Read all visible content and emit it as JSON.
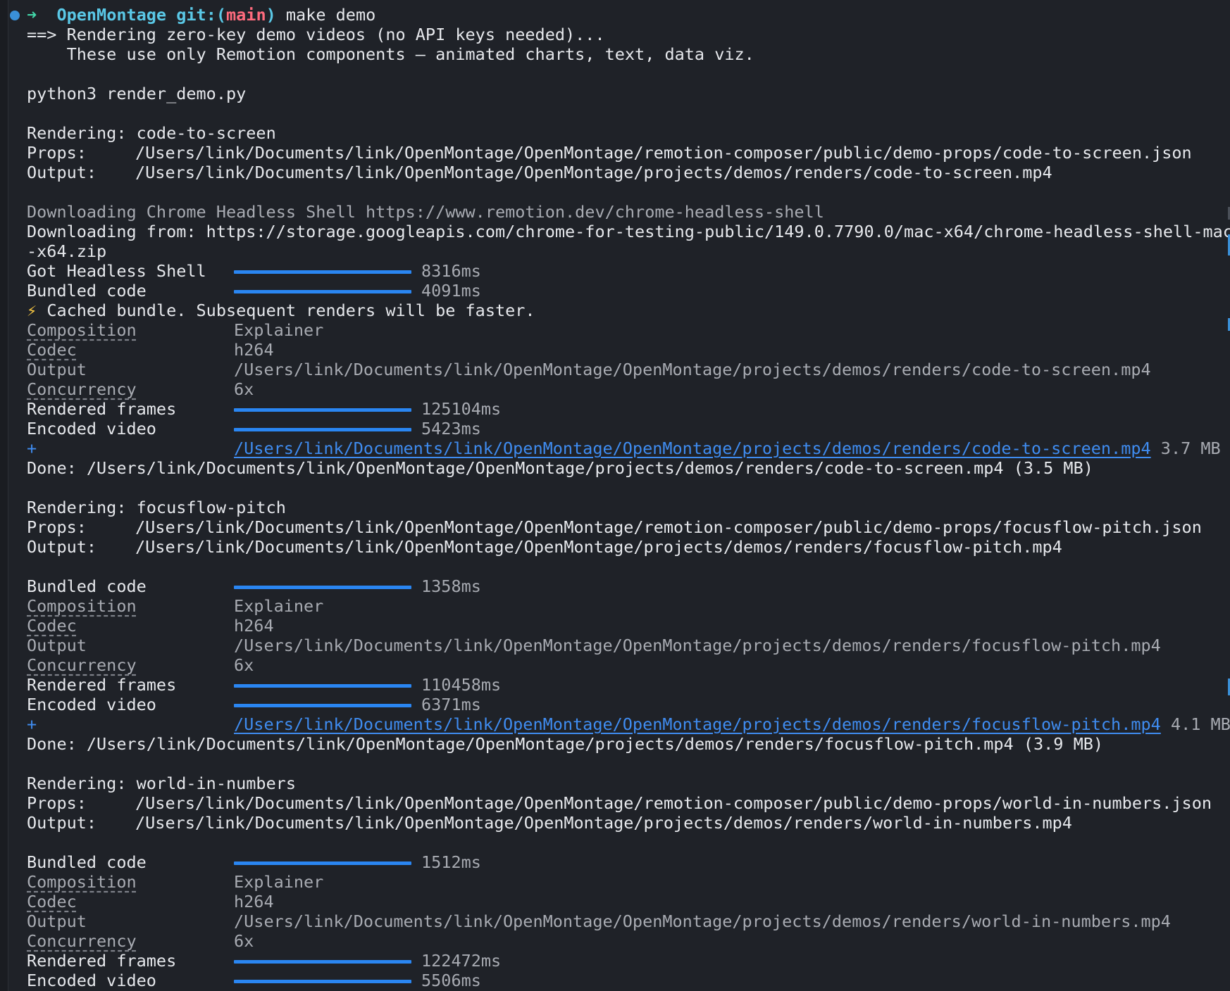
{
  "prompt": {
    "arrow": "➜",
    "dir": "OpenMontage",
    "git": "git:(",
    "branch": "main",
    "git_close": ")",
    "command": "make demo"
  },
  "intro": [
    "==> Rendering zero-key demo videos (no API keys needed)...",
    "    These use only Remotion components — animated charts, text, data viz."
  ],
  "script_cmd": "python3 render_demo.py",
  "download": {
    "line1": "Downloading Chrome Headless Shell https://www.remotion.dev/chrome-headless-shell",
    "line2": "Downloading from: https://storage.googleapis.com/chrome-for-testing-public/149.0.7790.0/mac-x64/chrome-headless-shell-mac",
    "line3": "-x64.zip",
    "got_label": "Got Headless Shell",
    "got_time": "8316ms",
    "got_progress": 1.0
  },
  "cached_icon": "⚡",
  "cached_text": "Cached bundle. Subsequent renders will be faster.",
  "labels": {
    "rendering": "Rendering:",
    "props": "Props:",
    "output": "Output:",
    "bundled": "Bundled code",
    "composition": "Composition",
    "codec": "Codec",
    "output2": "Output",
    "concurrency": "Concurrency",
    "rendered": "Rendered frames",
    "encoded": "Encoded video",
    "plus": "+",
    "done": "Done:"
  },
  "renders": [
    {
      "name": "code-to-screen",
      "props": "/Users/link/Documents/link/OpenMontage/OpenMontage/remotion-composer/public/demo-props/code-to-screen.json",
      "output": "/Users/link/Documents/link/OpenMontage/OpenMontage/projects/demos/renders/code-to-screen.mp4",
      "bundled_time": "4091ms",
      "composition": "Explainer",
      "codec": "h264",
      "concurrency": "6x",
      "rendered_time": "125104ms",
      "encoded_time": "5423ms",
      "progress": 1.0,
      "link_size": "3.7 MB",
      "done": "/Users/link/Documents/link/OpenMontage/OpenMontage/projects/demos/renders/code-to-screen.mp4 (3.5 MB)"
    },
    {
      "name": "focusflow-pitch",
      "props": "/Users/link/Documents/link/OpenMontage/OpenMontage/remotion-composer/public/demo-props/focusflow-pitch.json",
      "output": "/Users/link/Documents/link/OpenMontage/OpenMontage/projects/demos/renders/focusflow-pitch.mp4",
      "bundled_time": "1358ms",
      "composition": "Explainer",
      "codec": "h264",
      "concurrency": "6x",
      "rendered_time": "110458ms",
      "encoded_time": "6371ms",
      "progress": 1.0,
      "link_size": "4.1 MB",
      "done": "/Users/link/Documents/link/OpenMontage/OpenMontage/projects/demos/renders/focusflow-pitch.mp4 (3.9 MB)"
    },
    {
      "name": "world-in-numbers",
      "props": "/Users/link/Documents/link/OpenMontage/OpenMontage/remotion-composer/public/demo-props/world-in-numbers.json",
      "output": "/Users/link/Documents/link/OpenMontage/OpenMontage/projects/demos/renders/world-in-numbers.mp4",
      "bundled_time": "1512ms",
      "composition": "Explainer",
      "codec": "h264",
      "concurrency": "6x",
      "rendered_time": "122472ms",
      "encoded_time": "5506ms",
      "progress": 1.0
    }
  ]
}
